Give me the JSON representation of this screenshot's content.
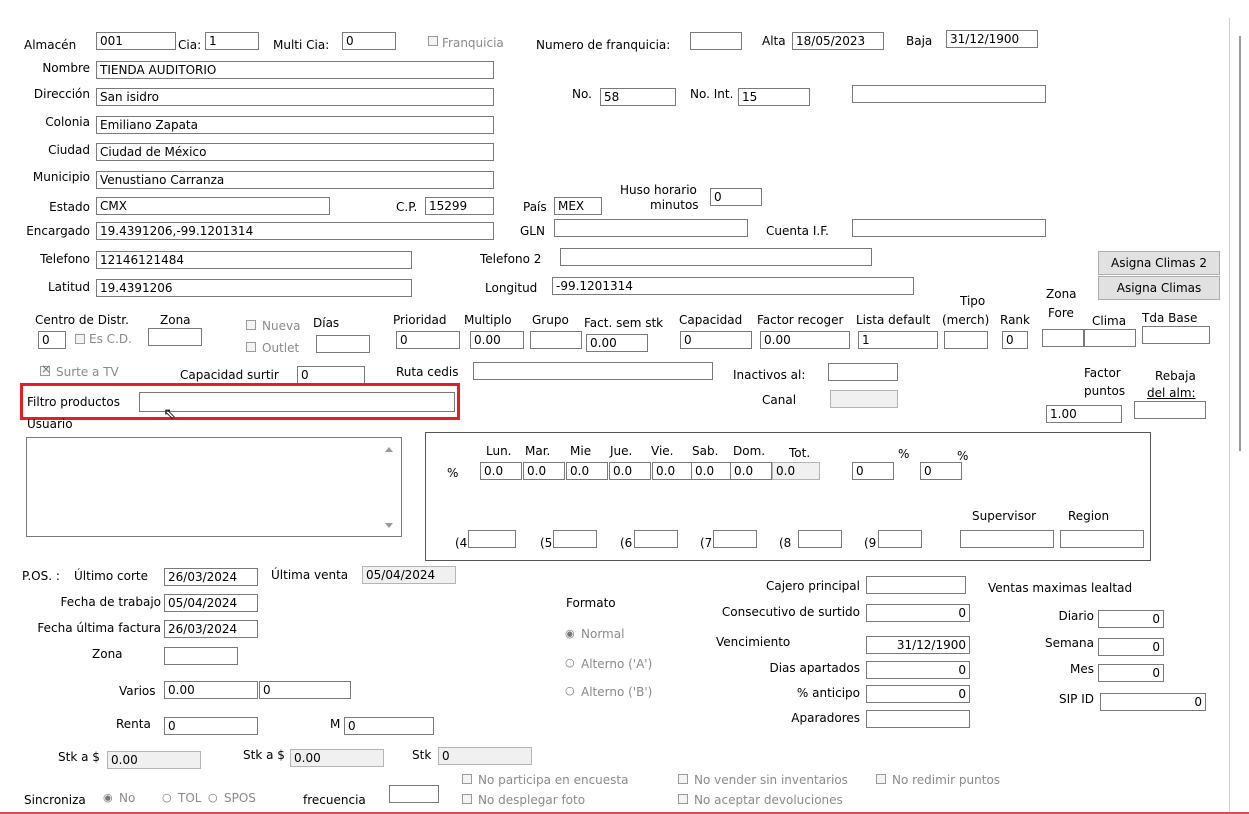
{
  "header": {
    "almacen_label": "Almacén",
    "almacen_value": "001",
    "cia_label": "Cia:",
    "cia_value": "1",
    "multicia_label": "Multi Cia:",
    "multicia_value": "0",
    "franquicia_label": "Franquicia",
    "num_franquicia_label": "Numero de franquicia:",
    "num_franquicia_value": "",
    "alta_label": "Alta",
    "alta_value": "18/05/2023",
    "baja_label": "Baja",
    "baja_value": "31/12/1900"
  },
  "general": {
    "nombre_label": "Nombre",
    "nombre_value": "TIENDA AUDITORIO",
    "direccion_label": "Dirección",
    "direccion_value": "San isidro",
    "no_label": "No.",
    "no_value": "58",
    "noint_label": "No. Int.",
    "noint_value": "15",
    "extra_value": "",
    "colonia_label": "Colonia",
    "colonia_value": "Emiliano Zapata",
    "ciudad_label": "Ciudad",
    "ciudad_value": "Ciudad de México",
    "municipio_label": "Municipio",
    "municipio_value": "Venustiano Carranza",
    "estado_label": "Estado",
    "estado_value": "CMX",
    "cp_label": "C.P.",
    "cp_value": "15299",
    "pais_label": "País",
    "pais_value": "MEX",
    "huso_label_1": "Huso horario",
    "huso_label_2": "minutos",
    "huso_value": "0",
    "encargado_label": "Encargado",
    "encargado_value": "19.4391206,-99.1201314",
    "gln_label": "GLN",
    "gln_value": "",
    "cuentaif_label": "Cuenta I.F.",
    "cuentaif_value": "",
    "telefono_label": "Telefono",
    "telefono_value": "12146121484",
    "telefono2_label": "Telefono 2",
    "telefono2_value": "",
    "latitud_label": "Latitud",
    "latitud_value": "19.4391206",
    "longitud_label": "Longitud",
    "longitud_value": "-99.1201314",
    "asigna_climas2": "Asigna Climas 2",
    "asigna_climas": "Asigna Climas"
  },
  "distr": {
    "centro_label": "Centro de Distr.",
    "centro_value": "0",
    "zona_label": "Zona",
    "esdc_label": "Es C.D.",
    "zona_value": "",
    "nueva_label": "Nueva",
    "outlet_label": "Outlet",
    "dias_label": "Días",
    "dias_value": "",
    "prioridad_label": "Prioridad",
    "prioridad_value": "0",
    "multiplo_label": "Multiplo",
    "multiplo_value": "0.00",
    "grupo_label": "Grupo",
    "grupo_value": "",
    "factsem_label": "Fact. sem stk",
    "factsem_value": "0.00",
    "capacidad_label": "Capacidad",
    "capacidad_value": "0",
    "factrec_label": "Factor recoger",
    "factrec_value": "0.00",
    "listadef_label": "Lista default",
    "listadef_value": "1",
    "tipo_label_1": "Tipo",
    "tipo_label_2": "(merch)",
    "tipo_value": "",
    "rank_label": "Rank",
    "rank_value": "0",
    "zonafore_label_1": "Zona",
    "zonafore_label_2": "Fore",
    "zonafore_value": "",
    "clima_label": "Clima",
    "clima_value": "",
    "tdabase_label": "Tda Base",
    "tdabase_value": ""
  },
  "row2": {
    "surte_label": "Surte a TV",
    "capsurtir_label": "Capacidad surtir",
    "capsurtir_value": "0",
    "rutacedis_label": "Ruta cedis",
    "rutacedis_value": "",
    "inactivos_label": "Inactivos al:",
    "inactivos_value": "",
    "canal_label": "Canal",
    "canal_value": "",
    "factorpuntos_label_1": "Factor",
    "factorpuntos_label_2": "puntos",
    "factorpuntos_value": "1.00",
    "rebaja_label_1": "Rebaja",
    "rebaja_label_2": "del alm:",
    "rebaja_value": "",
    "filtro_label": "Filtro productos",
    "filtro_value": "",
    "usuario_label": "Usuario"
  },
  "week": {
    "pct_label": "%",
    "days": [
      "Lun.",
      "Mar.",
      "Mie",
      "Jue.",
      "Vie.",
      "Sab.",
      "Dom.",
      "Tot."
    ],
    "values": [
      "0.0",
      "0.0",
      "0.0",
      "0.0",
      "0.0",
      "0.0",
      "0.0",
      "0.0"
    ],
    "pct1_label": "%",
    "pct1_value": "0",
    "pct2_label": "%",
    "pct2_value": "0",
    "p4_label": "(4",
    "p5_label": "(5",
    "p6_label": "(6",
    "p7_label": "(7",
    "p8_label": "(8",
    "p9_label": "(9",
    "supervisor_label": "Supervisor",
    "region_label": "Region"
  },
  "pos": {
    "title": "P.OS. :",
    "ultimo_corte_label": "Último corte",
    "ultimo_corte_value": "26/03/2024",
    "ultima_venta_label": "Última venta",
    "ultima_venta_value": "05/04/2024",
    "fecha_trabajo_label": "Fecha de trabajo",
    "fecha_trabajo_value": "05/04/2024",
    "fecha_factura_label": "Fecha última factura",
    "fecha_factura_value": "26/03/2024",
    "zona_label": "Zona",
    "zona_value": "",
    "varios_label": "Varios",
    "varios_value1": "0.00",
    "varios_value2": "0",
    "renta_label": "Renta",
    "renta_value": "0",
    "m_label": "M",
    "m_value": "0",
    "stk1_label": "Stk a $",
    "stk1_value": "0.00",
    "stk2_label": "Stk a $",
    "stk2_value": "0.00",
    "stk3_label": "Stk",
    "stk3_value": "0",
    "formato_label": "Formato",
    "formato_options": [
      "Normal",
      "Alterno ('A')",
      "Alterno ('B')"
    ],
    "cajero_label": "Cajero principal",
    "cajero_value": "",
    "consec_label": "Consecutivo de surtido",
    "consec_value": "0",
    "venc_label": "Vencimiento",
    "venc_value": "31/12/1900",
    "diasap_label": "Dias apartados",
    "diasap_value": "0",
    "anticipo_label": "% anticipo",
    "anticipo_value": "0",
    "aparadores_label": "Aparadores",
    "aparadores_value": "",
    "ventas_label": "Ventas maximas lealtad",
    "diario_label": "Diario",
    "diario_value": "0",
    "semana_label": "Semana",
    "semana_value": "0",
    "mes_label": "Mes",
    "mes_value": "0",
    "sipid_label": "SIP ID",
    "sipid_value": "0"
  },
  "footer": {
    "sincroniza_label": "Sincroniza",
    "sinc_options": [
      "No",
      "TOL",
      "SPOS"
    ],
    "frecuencia_label": "frecuencia",
    "frecuencia_value": "",
    "no_encuesta": "No participa en encuesta",
    "no_foto": "No desplegar foto",
    "no_vender": "No vender sin inventarios",
    "no_devol": "No aceptar devoluciones",
    "no_redimir": "No redimir puntos"
  },
  "colors": {
    "highlight": "#e31e24",
    "disabled_text": "#8a8a8a"
  }
}
